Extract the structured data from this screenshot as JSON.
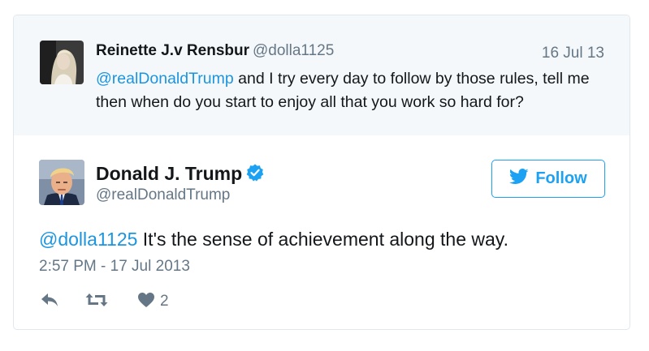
{
  "parent_tweet": {
    "author_name": "Reinette J.v Rensbur",
    "author_handle": "@dolla1125",
    "date": "16 Jul 13",
    "mention": "@realDonaldTrump",
    "text": " and I try every day to follow by those rules, tell me then when do you start to enjoy all that you work so hard for?"
  },
  "main_tweet": {
    "author_name": "Donald J. Trump",
    "author_handle": "@realDonaldTrump",
    "verified": true,
    "follow_label": "Follow",
    "mention": "@dolla1125",
    "text": " It's the sense of achievement along the way.",
    "timestamp": "2:57 PM - 17 Jul 2013",
    "like_count": "2"
  },
  "icons": [
    "reply-icon",
    "retweet-icon",
    "heart-icon",
    "twitter-bird-icon",
    "verified-badge-icon"
  ],
  "colors": {
    "accent": "#1da1f2",
    "link": "#1b95e0",
    "muted": "#657786",
    "parent_bg": "#f5f8fa",
    "border": "#e1e8ed"
  }
}
